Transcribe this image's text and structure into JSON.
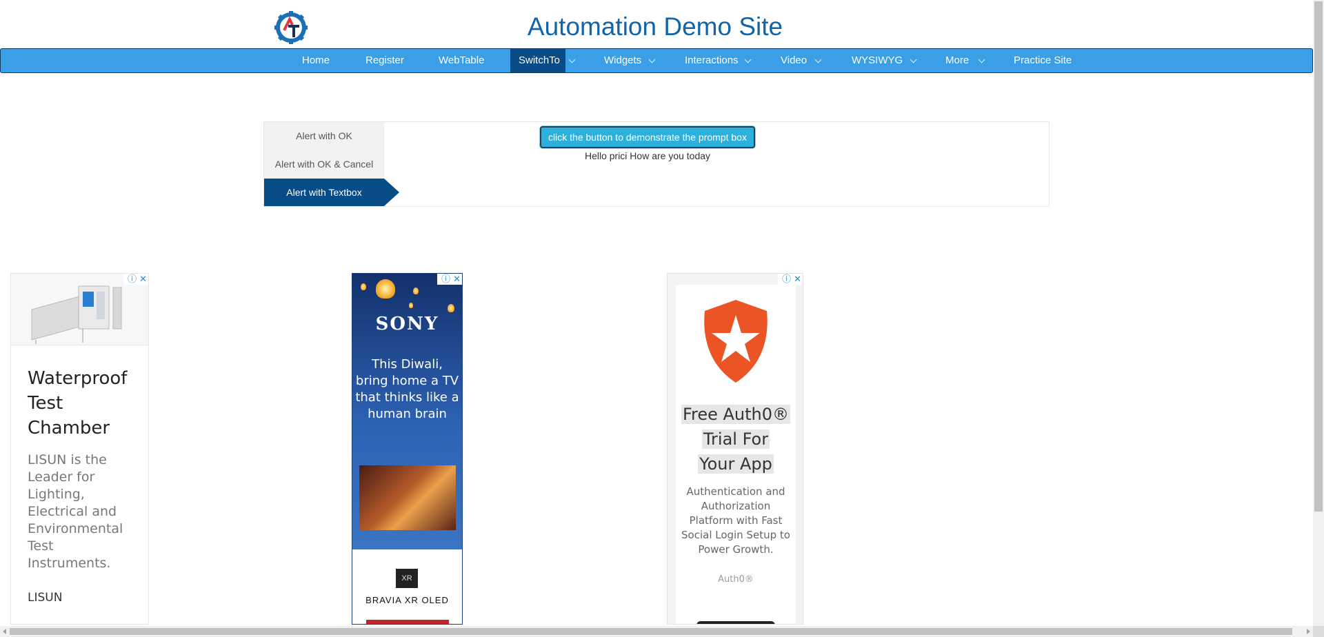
{
  "header": {
    "title": "Automation Demo Site",
    "logo_icon": "gear-logo-icon"
  },
  "nav": {
    "items": [
      {
        "label": "Home"
      },
      {
        "label": "Register"
      },
      {
        "label": "WebTable"
      },
      {
        "label": "SwitchTo",
        "active": true
      },
      {
        "label": "Widgets"
      },
      {
        "label": "Interactions"
      },
      {
        "label": "Video"
      },
      {
        "label": "WYSIWYG"
      },
      {
        "label": "More"
      },
      {
        "label": "Practice Site"
      }
    ]
  },
  "alerts": {
    "tabs": [
      {
        "label": "Alert with OK"
      },
      {
        "label": "Alert with OK & Cancel"
      },
      {
        "label": "Alert with Textbox",
        "active": true
      }
    ],
    "button_label": "click the button to demonstrate the prompt box",
    "result_text": "Hello prici How are you today"
  },
  "ads": {
    "lisun": {
      "headline": "Waterproof Test Chamber",
      "body": "LISUN is the Leader for Lighting, Electrical and Environmental Test Instruments.",
      "brand": "LISUN"
    },
    "sony": {
      "logo": "SONY",
      "headline": "This Diwali, bring home a TV that thinks like a human brain",
      "badge": "XR",
      "brand": "BRAVIA XR OLED"
    },
    "auth0": {
      "headline": [
        "Free Auth0®",
        "Trial For",
        "Your App"
      ],
      "body": "Authentication and Authorization Platform with Fast Social Login Setup to Power Growth.",
      "brand": "Auth0®"
    },
    "info_glyph": "ⓘ",
    "close_glyph": "✕"
  },
  "colors": {
    "title": "#1164a8",
    "nav_bg": "#3b9fe7",
    "nav_active": "#074b87",
    "button_bg": "#2db0dc"
  }
}
